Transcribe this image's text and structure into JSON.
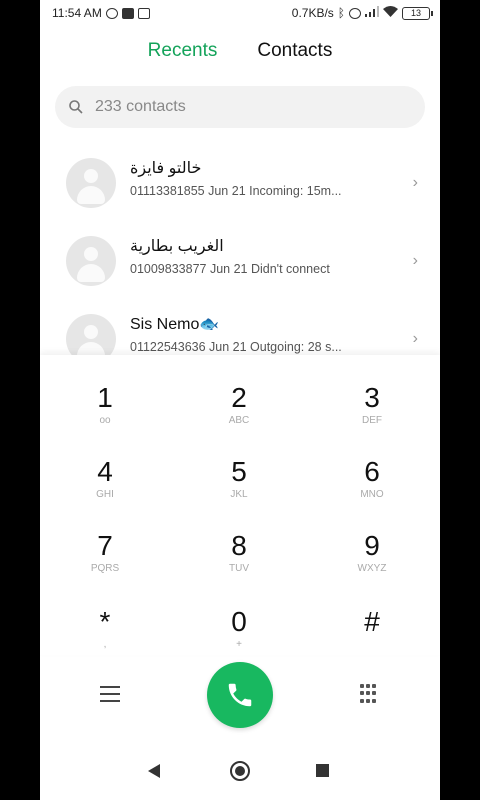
{
  "status_bar": {
    "time": "11:54 AM",
    "left_icons": [
      "whatsapp-icon",
      "video-icon",
      "mail-icon"
    ],
    "network_speed": "0.7KB/s",
    "battery": "13"
  },
  "tabs": [
    {
      "label": "Recents",
      "active": true
    },
    {
      "label": "Contacts",
      "active": false
    }
  ],
  "search": {
    "placeholder": "233 contacts"
  },
  "recents": [
    {
      "name": "خالتو فايزة",
      "number": "01113381855",
      "detail": "Jun 21 Incoming: 15m..."
    },
    {
      "name": "الغريب بطارية",
      "number": "01009833877",
      "detail": "Jun 21 Didn't connect"
    },
    {
      "name": "Sis Nemo🐟",
      "number": "01122543636",
      "detail": "Jun 21 Outgoing: 28 s..."
    }
  ],
  "keypad": [
    {
      "digit": "1",
      "letters": "oo"
    },
    {
      "digit": "2",
      "letters": "ABC"
    },
    {
      "digit": "3",
      "letters": "DEF"
    },
    {
      "digit": "4",
      "letters": "GHI"
    },
    {
      "digit": "5",
      "letters": "JKL"
    },
    {
      "digit": "6",
      "letters": "MNO"
    },
    {
      "digit": "7",
      "letters": "PQRS"
    },
    {
      "digit": "8",
      "letters": "TUV"
    },
    {
      "digit": "9",
      "letters": "WXYZ"
    },
    {
      "digit": "*",
      "letters": ","
    },
    {
      "digit": "0",
      "letters": "+"
    },
    {
      "digit": "#",
      "letters": ""
    }
  ],
  "colors": {
    "accent": "#14a35a",
    "call_button": "#18b860"
  }
}
